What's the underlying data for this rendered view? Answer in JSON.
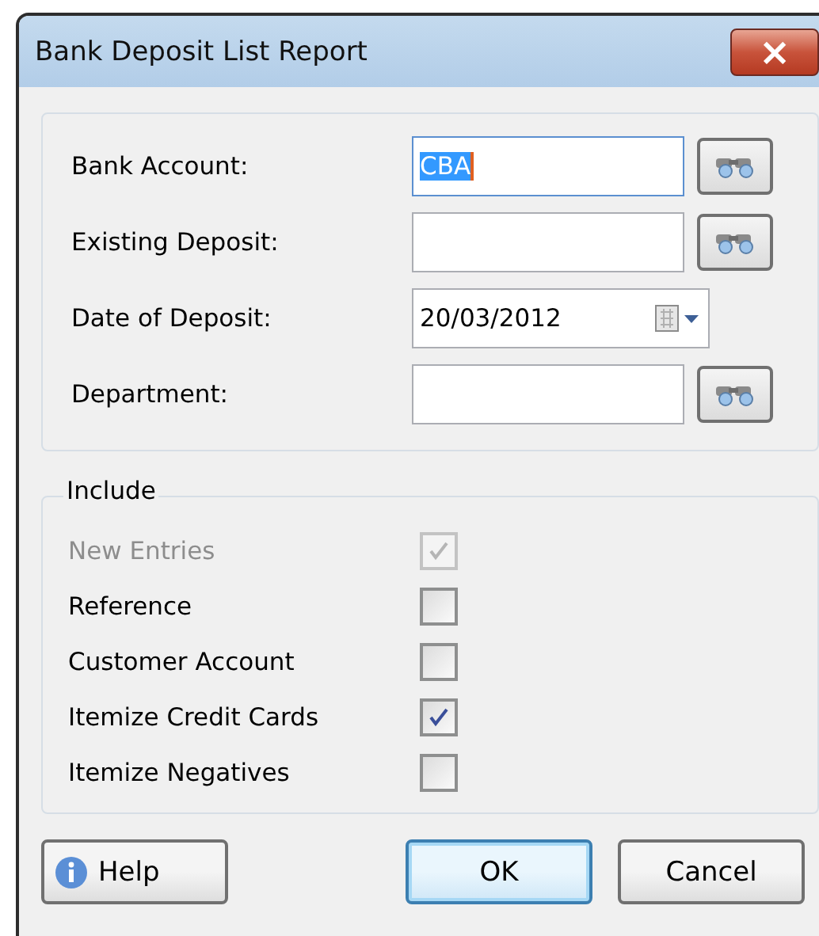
{
  "window": {
    "title": "Bank Deposit List Report",
    "close": "×"
  },
  "fields": [
    {
      "kind": "lookup",
      "label": "Bank Account:",
      "value": "CBA",
      "focused": true
    },
    {
      "kind": "lookup",
      "label": "Existing Deposit:",
      "focused": false
    },
    {
      "kind": "date",
      "label": "Date of Deposit:",
      "value": "20/03/2012",
      "focused": false
    },
    {
      "kind": "lookup",
      "label": "Department:",
      "focused": false
    }
  ],
  "include": {
    "title": "Include",
    "options": [
      {
        "label": "New Entries",
        "checked": true,
        "disabled": true
      },
      {
        "label": "Reference",
        "checked": false,
        "disabled": false
      },
      {
        "label": "Customer Account",
        "checked": false,
        "disabled": false
      },
      {
        "label": "Itemize Credit Cards",
        "checked": true,
        "disabled": false
      },
      {
        "label": "Itemize Negatives",
        "checked": false,
        "disabled": false
      }
    ]
  },
  "buttons": [
    {
      "kind": "help",
      "label": "Help",
      "default": false
    },
    {
      "kind": "ok",
      "label": "OK",
      "default": true
    },
    {
      "kind": "cancel",
      "label": "Cancel",
      "default": false
    }
  ]
}
